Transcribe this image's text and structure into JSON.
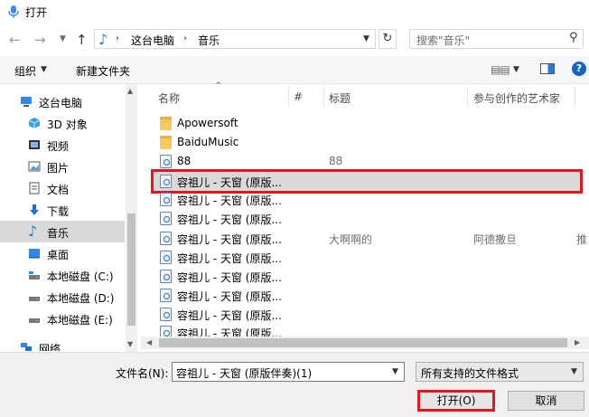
{
  "window": {
    "title": "打开",
    "app_icon": "microphone-icon"
  },
  "nav": {
    "back_icon": "arrow-left-icon",
    "forward_icon": "arrow-right-icon",
    "recent_icon": "chevron-down-icon",
    "up_icon": "arrow-up-icon",
    "breadcrumb": [
      "这台电脑",
      "音乐"
    ],
    "separator": "›",
    "refresh_icon": "refresh-icon",
    "search_placeholder": "搜索\"音乐\"",
    "search_icon": "search-icon"
  },
  "toolbar": {
    "organize_label": "组织",
    "new_folder_label": "新建文件夹",
    "view_icon": "view-options-icon",
    "preview_icon": "preview-pane-icon",
    "help_icon": "help-icon",
    "help_glyph": "?"
  },
  "sidebar": {
    "items": [
      {
        "label": "这台电脑",
        "icon": "computer-icon"
      },
      {
        "label": "3D 对象",
        "icon": "cube-icon"
      },
      {
        "label": "视频",
        "icon": "video-icon"
      },
      {
        "label": "图片",
        "icon": "picture-icon"
      },
      {
        "label": "文档",
        "icon": "document-icon"
      },
      {
        "label": "下载",
        "icon": "download-icon"
      },
      {
        "label": "音乐",
        "icon": "music-icon",
        "selected": true
      },
      {
        "label": "桌面",
        "icon": "desktop-icon"
      },
      {
        "label": "本地磁盘 (C:)",
        "icon": "drive-icon"
      },
      {
        "label": "本地磁盘 (D:)",
        "icon": "drive-icon"
      },
      {
        "label": "本地磁盘 (E:)",
        "icon": "drive-icon"
      },
      {
        "label": "网络",
        "icon": "network-icon"
      }
    ]
  },
  "columns": {
    "name": "名称",
    "number": "#",
    "title": "标题",
    "artists": "参与创作的艺术家"
  },
  "files": [
    {
      "name": "Apowersoft",
      "type": "folder",
      "number": "",
      "title": "",
      "artist": "",
      "extra": ""
    },
    {
      "name": "BaiduMusic",
      "type": "folder",
      "number": "",
      "title": "",
      "artist": "",
      "extra": ""
    },
    {
      "name": "88",
      "type": "audio",
      "number": "",
      "title": "88",
      "artist": "",
      "extra": ""
    },
    {
      "name": "容祖儿 - 天窗 (原版...",
      "type": "audio",
      "number": "",
      "title": "",
      "artist": "",
      "extra": "",
      "selected": true
    },
    {
      "name": "容祖儿 - 天窗 (原版...",
      "type": "audio",
      "number": "",
      "title": "",
      "artist": "",
      "extra": ""
    },
    {
      "name": "容祖儿 - 天窗 (原版...",
      "type": "audio",
      "number": "",
      "title": "",
      "artist": "",
      "extra": ""
    },
    {
      "name": "容祖儿 - 天窗 (原版...",
      "type": "audio",
      "number": "",
      "title": "大啊啊的",
      "artist": "阿德撒旦",
      "extra": "推"
    },
    {
      "name": "容祖儿 - 天窗 (原版...",
      "type": "audio",
      "number": "",
      "title": "",
      "artist": "",
      "extra": ""
    },
    {
      "name": "容祖儿 - 天窗 (原版...",
      "type": "audio",
      "number": "",
      "title": "",
      "artist": "",
      "extra": ""
    },
    {
      "name": "容祖儿 - 天窗 (原版...",
      "type": "audio",
      "number": "",
      "title": "",
      "artist": "",
      "extra": ""
    },
    {
      "name": "容祖儿 - 天窗 (原版...",
      "type": "audio",
      "number": "",
      "title": "",
      "artist": "",
      "extra": ""
    },
    {
      "name": "容祖儿 - 天窗 (原版...",
      "type": "audio",
      "number": "",
      "title": "",
      "artist": "",
      "extra": ""
    }
  ],
  "footer": {
    "filename_label": "文件名(N):",
    "filename_value": "容祖儿 - 天窗 (原版伴奏)(1)",
    "filter_value": "所有支持的文件格式",
    "open_label": "打开(O)",
    "cancel_label": "取消"
  },
  "colors": {
    "accent": "#1e7fd6",
    "highlight_border": "#e8141c",
    "selection_bg": "#d9d9d9"
  }
}
